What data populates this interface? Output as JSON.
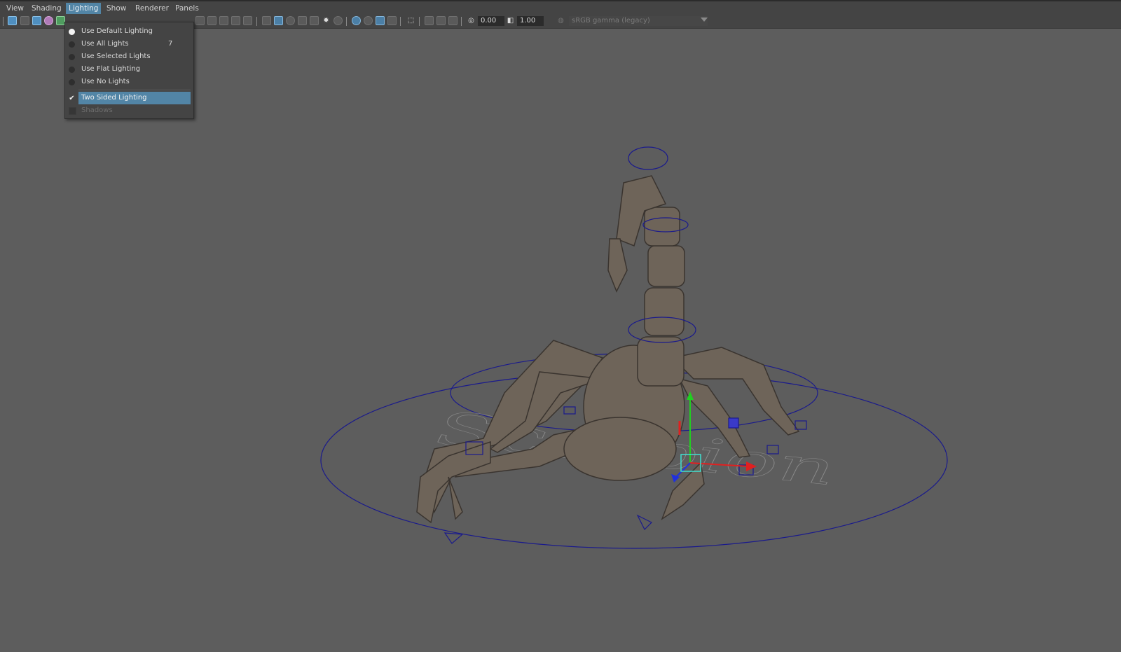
{
  "menubar": {
    "items": [
      {
        "label": "View"
      },
      {
        "label": "Shading"
      },
      {
        "label": "Lighting"
      },
      {
        "label": "Show"
      },
      {
        "label": "Renderer"
      },
      {
        "label": "Panels"
      }
    ],
    "active": "Lighting"
  },
  "toolbar": {
    "exposure_value": "0.00",
    "gamma_value": "1.00",
    "color_space": "sRGB gamma (legacy)"
  },
  "lighting_menu": {
    "items": [
      {
        "label": "Use Default Lighting",
        "control": "radio",
        "selected": true,
        "shortcut": ""
      },
      {
        "label": "Use All Lights",
        "control": "radio",
        "selected": false,
        "shortcut": "7"
      },
      {
        "label": "Use Selected Lights",
        "control": "radio",
        "selected": false,
        "shortcut": ""
      },
      {
        "label": "Use Flat Lighting",
        "control": "radio",
        "selected": false,
        "shortcut": ""
      },
      {
        "label": "Use No Lights",
        "control": "radio",
        "selected": false,
        "shortcut": ""
      },
      {
        "label": "Two Sided Lighting",
        "control": "checkbox",
        "checked": true,
        "highlighted": true
      },
      {
        "label": "Shadows",
        "control": "checkbox",
        "checked": false,
        "disabled": true
      }
    ]
  },
  "viewport": {
    "floor_text": "Scorpion",
    "colors": {
      "background": "#5d5d5d",
      "rig_controls": "#1a1a8c",
      "model": "#6e6459",
      "axis_x": "#e02020",
      "axis_y": "#20d020",
      "axis_z": "#2030e0",
      "selection": "#40e0d0"
    }
  }
}
